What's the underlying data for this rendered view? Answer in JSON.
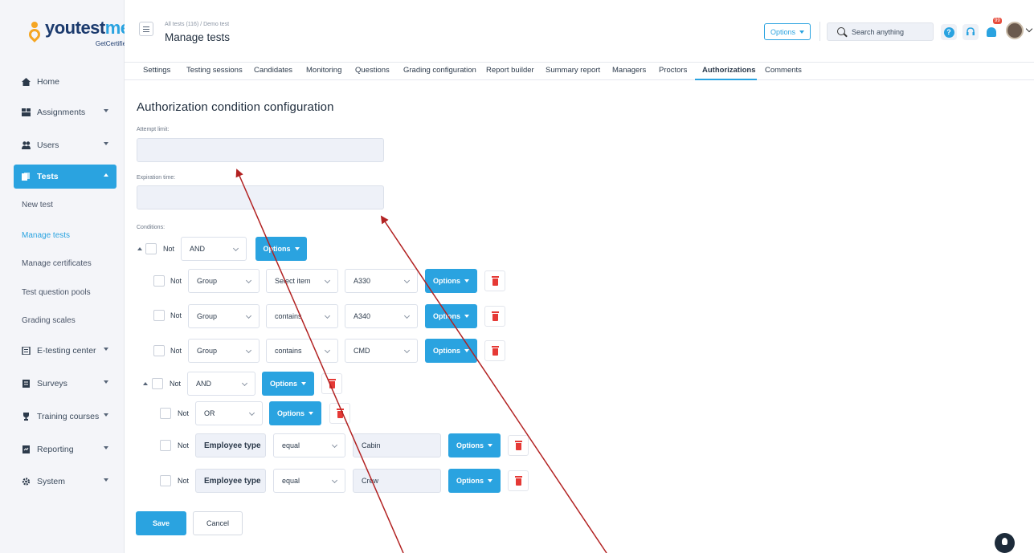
{
  "brand": {
    "name_a": "youtest",
    "name_b": "me",
    "tagline": "GetCertified"
  },
  "sidebar": {
    "items": [
      {
        "label": "Home",
        "icon": "home-icon"
      },
      {
        "label": "Assignments",
        "icon": "assignments-icon"
      },
      {
        "label": "Users",
        "icon": "users-icon"
      },
      {
        "label": "Tests",
        "icon": "tests-icon"
      },
      {
        "label": "E-testing center",
        "icon": "e-testing-icon"
      },
      {
        "label": "Surveys",
        "icon": "surveys-icon"
      },
      {
        "label": "Training courses",
        "icon": "training-icon"
      },
      {
        "label": "Reporting",
        "icon": "reporting-icon"
      },
      {
        "label": "System",
        "icon": "gear-icon"
      }
    ],
    "sub_items": [
      "New test",
      "Manage tests",
      "Manage certificates",
      "Test question pools",
      "Grading scales"
    ]
  },
  "header": {
    "breadcrumb": "All tests (116)  /  Demo test",
    "title": "Manage tests",
    "options_label": "Options",
    "search_placeholder": "Search anything",
    "help_label": "?",
    "notification_badge": "99"
  },
  "tabs": [
    "Settings",
    "Testing sessions",
    "Candidates",
    "Monitoring",
    "Questions",
    "Grading configuration",
    "Report builder",
    "Summary report",
    "Managers",
    "Proctors",
    "Authorizations",
    "Comments"
  ],
  "form": {
    "title": "Authorization condition configuration",
    "attempt_limit_label": "Attempt limit:",
    "expiration_time_label": "Expiration time:",
    "conditions_label": "Conditions:"
  },
  "conditions": {
    "not_label": "Not",
    "options_label": "Options",
    "root_operator": "AND",
    "rows": [
      {
        "field": "Group",
        "operator": "Select item",
        "value": "A330"
      },
      {
        "field": "Group",
        "operator": "contains",
        "value": "A340"
      },
      {
        "field": "Group",
        "operator": "contains",
        "value": "CMD"
      }
    ],
    "nested_operator": "AND",
    "inner_operator": "OR",
    "inner_rows": [
      {
        "field": "Employee type",
        "operator": "equal",
        "value": "Cabin"
      },
      {
        "field": "Employee type",
        "operator": "equal",
        "value": "Crew"
      }
    ]
  },
  "actions": {
    "save": "Save",
    "cancel": "Cancel"
  },
  "colors": {
    "accent": "#2aa3e0",
    "danger": "#e53935",
    "annotation_arrow": "#b22222"
  }
}
